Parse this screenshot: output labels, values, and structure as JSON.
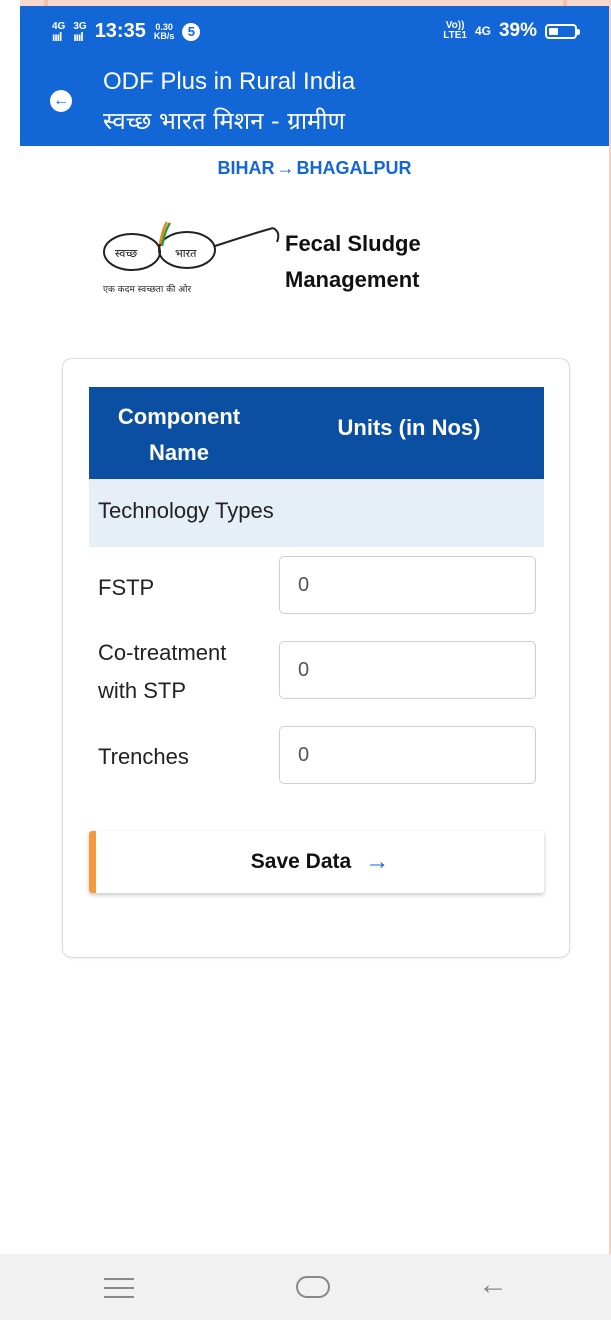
{
  "status_bar": {
    "network_left_1": "4G",
    "network_left_2": "3G",
    "time": "13:35",
    "speed_value": "0.30",
    "speed_unit": "KB/s",
    "notification_count": "5",
    "volte_top": "Vo))",
    "volte_bottom": "LTE1",
    "network_right": "4G",
    "battery_percent": "39%",
    "battery_level": 0.39
  },
  "header": {
    "title": "ODF Plus in Rural India",
    "subtitle": "स्वच्छ भारत मिशन - ग्रामीण",
    "back_icon": "arrow-left-circle-icon"
  },
  "breadcrumb": {
    "state": "BIHAR",
    "district": "BHAGALPUR",
    "arrow": "→"
  },
  "logo": {
    "left_word": "स्वच्छ",
    "right_word": "भारत",
    "tagline": "एक कदम स्वच्छता की ओर",
    "title_line1": "Fecal Sludge",
    "title_line2": "Management"
  },
  "table": {
    "col1_header_line1": "Component",
    "col1_header_line2": "Name",
    "col2_header": "Units (in Nos)",
    "section_title": "Technology Types",
    "rows": [
      {
        "label_line1": "FSTP",
        "label_line2": "",
        "value": "0"
      },
      {
        "label_line1": "Co-treatment",
        "label_line2": "with STP",
        "value": "0"
      },
      {
        "label_line1": "Trenches",
        "label_line2": "",
        "value": "0"
      }
    ]
  },
  "save_button": {
    "label": "Save Data",
    "arrow": "→",
    "accent_color": "#f59a3a"
  },
  "colors": {
    "primary": "#1266d6",
    "table_header": "#0b4fa2",
    "section_bg": "#e6eef8"
  },
  "nav_bar": {
    "menu_icon": "menu-icon",
    "home_icon": "home-pill-icon",
    "back_icon": "back-arrow-icon",
    "back_glyph": "←"
  }
}
